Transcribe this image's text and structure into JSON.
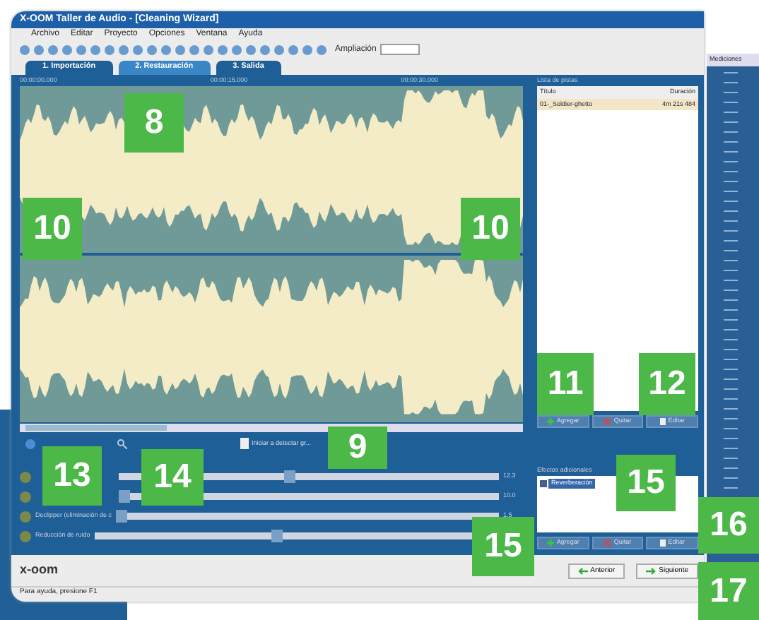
{
  "window": {
    "title": "X-OOM Taller de Audio - [Cleaning Wizard]"
  },
  "menu": [
    "Archivo",
    "Editar",
    "Proyecto",
    "Opciones",
    "Ventana",
    "Ayuda"
  ],
  "toolbar": {
    "zoom_label": "Ampliación"
  },
  "tabs": [
    {
      "label": "1. Importación",
      "selected": false
    },
    {
      "label": "2. Restauración",
      "selected": true
    },
    {
      "label": "3. Salida",
      "selected": false
    }
  ],
  "waveform": {
    "time_marks": [
      "00:00:00.000",
      "00:00:15.000",
      "00:00:30.000"
    ]
  },
  "track_list": {
    "title": "Lista de pistas",
    "columns": [
      "Título",
      "Duración"
    ],
    "rows": [
      {
        "cells": [
          "01-_Soldier-ghetto",
          "4m 21s 484"
        ],
        "selected": true
      }
    ],
    "buttons": [
      {
        "label": "Agregar",
        "kind": "add"
      },
      {
        "label": "Quitar",
        "kind": "remove"
      },
      {
        "label": "Editar",
        "kind": "edit"
      }
    ]
  },
  "detect_button": "Iniciar a detectar gr...",
  "effects": [
    {
      "level": 0.45,
      "reading": "12.3"
    },
    {
      "level": 0.0,
      "reading": "10.0"
    },
    {
      "label": "Declipper (eliminación de c",
      "level": 0.0,
      "reading": "1.5"
    },
    {
      "label": "Reducción de ruido",
      "level": 0.45
    }
  ],
  "extra_effects": {
    "title": "Efectos adicionales",
    "items": [
      {
        "label": "Reverberación",
        "checked": true
      }
    ],
    "buttons": [
      {
        "label": "Agregar",
        "kind": "add"
      },
      {
        "label": "Quitar",
        "kind": "remove"
      },
      {
        "label": "Editar",
        "kind": "edit"
      }
    ]
  },
  "logo": "x-oom",
  "nav_buttons": [
    {
      "label": "Anterior",
      "kind": "back"
    },
    {
      "label": "Siguiente",
      "kind": "next"
    }
  ],
  "status_bar": "Para ayuda, presione F1",
  "meter": {
    "title": "Mediciones"
  },
  "callouts": [
    "8",
    "10",
    "10",
    "9",
    "11",
    "12",
    "13",
    "14",
    "15",
    "15",
    "16",
    "17"
  ]
}
